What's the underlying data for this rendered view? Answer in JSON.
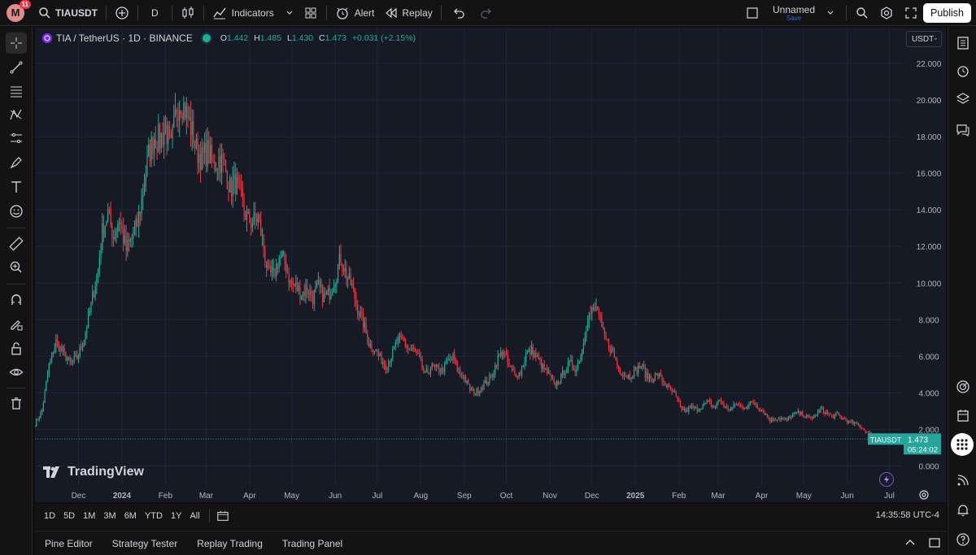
{
  "topbar": {
    "avatar_letter": "M",
    "notification_count": "11",
    "symbol": "TIAUSDT",
    "interval": "D",
    "indicators_label": "Indicators",
    "alert_label": "Alert",
    "replay_label": "Replay",
    "layout_name": "Unnamed",
    "save_label": "Save",
    "publish_label": "Publish"
  },
  "legend": {
    "title": "TIA / TetherUS · 1D · BINANCE",
    "o_label": "O",
    "o": "1.442",
    "h_label": "H",
    "h": "1.485",
    "l_label": "L",
    "l": "1.430",
    "c_label": "C",
    "c": "1.473",
    "change": "+0.031 (+2.15%)"
  },
  "currency": "USDT",
  "brand": "TradingView",
  "price_label": {
    "symbol": "TIAUSDT",
    "price": "1.473",
    "countdown": "05:24:02"
  },
  "ranges": [
    "1D",
    "5D",
    "1M",
    "3M",
    "6M",
    "YTD",
    "1Y",
    "All"
  ],
  "clock": "14:35:58 UTC-4",
  "bottom_tabs": [
    "Pine Editor",
    "Strategy Tester",
    "Replay Trading",
    "Trading Panel"
  ],
  "colors": {
    "up": "#22ab94",
    "down": "#f23645",
    "background": "#161a25",
    "label": "#26a69a"
  },
  "chart_data": {
    "type": "candlestick",
    "symbol": "TIAUSDT",
    "interval": "1D",
    "y_ticks": [
      0,
      2,
      4,
      6,
      8,
      10,
      12,
      14,
      16,
      18,
      20,
      22
    ],
    "y_tick_labels": [
      "0.000",
      "2.000",
      "4.000",
      "6.000",
      "8.000",
      "10.000",
      "12.000",
      "14.000",
      "16.000",
      "18.000",
      "20.000",
      "22.000"
    ],
    "ylim": [
      -1.0,
      22.8
    ],
    "x_tick_labels": [
      "Dec",
      "2024",
      "Feb",
      "Mar",
      "Apr",
      "May",
      "Jun",
      "Jul",
      "Aug",
      "Sep",
      "Oct",
      "Nov",
      "Dec",
      "2025",
      "Feb",
      "Mar",
      "Apr",
      "May",
      "Jun",
      "Jul"
    ],
    "x_tick_dates": [
      "2023-12-01",
      "2024-01-01",
      "2024-02-01",
      "2024-03-01",
      "2024-04-01",
      "2024-05-01",
      "2024-06-01",
      "2024-07-01",
      "2024-08-01",
      "2024-09-01",
      "2024-10-01",
      "2024-11-01",
      "2024-12-01",
      "2025-01-01",
      "2025-02-01",
      "2025-03-01",
      "2025-04-01",
      "2025-05-01",
      "2025-06-01",
      "2025-07-01"
    ],
    "start_date": "2023-10-31",
    "last_close": 1.473,
    "close_path": [
      [
        "2023-10-31",
        2.3
      ],
      [
        "2023-11-05",
        3.0
      ],
      [
        "2023-11-10",
        5.5
      ],
      [
        "2023-11-15",
        6.8
      ],
      [
        "2023-11-20",
        6.2
      ],
      [
        "2023-11-25",
        5.6
      ],
      [
        "2023-11-30",
        5.9
      ],
      [
        "2023-12-05",
        7.0
      ],
      [
        "2023-12-10",
        8.8
      ],
      [
        "2023-12-15",
        10.8
      ],
      [
        "2023-12-18",
        12.8
      ],
      [
        "2023-12-22",
        13.8
      ],
      [
        "2023-12-26",
        12.5
      ],
      [
        "2023-12-30",
        13.5
      ],
      [
        "2024-01-04",
        11.8
      ],
      [
        "2024-01-08",
        12.4
      ],
      [
        "2024-01-12",
        13.2
      ],
      [
        "2024-01-16",
        15.0
      ],
      [
        "2024-01-20",
        17.0
      ],
      [
        "2024-01-24",
        18.0
      ],
      [
        "2024-01-28",
        17.8
      ],
      [
        "2024-02-01",
        18.5
      ],
      [
        "2024-02-05",
        17.3
      ],
      [
        "2024-02-09",
        19.6
      ],
      [
        "2024-02-12",
        20.0
      ],
      [
        "2024-02-15",
        19.5
      ],
      [
        "2024-02-19",
        18.5
      ],
      [
        "2024-02-23",
        17.3
      ],
      [
        "2024-02-27",
        16.8
      ],
      [
        "2024-03-02",
        17.2
      ],
      [
        "2024-03-06",
        16.4
      ],
      [
        "2024-03-10",
        16.8
      ],
      [
        "2024-03-14",
        16.4
      ],
      [
        "2024-03-18",
        15.2
      ],
      [
        "2024-03-22",
        15.5
      ],
      [
        "2024-03-26",
        14.6
      ],
      [
        "2024-03-30",
        13.5
      ],
      [
        "2024-04-03",
        13.3
      ],
      [
        "2024-04-07",
        13.6
      ],
      [
        "2024-04-11",
        12.0
      ],
      [
        "2024-04-14",
        10.5
      ],
      [
        "2024-04-18",
        10.4
      ],
      [
        "2024-04-22",
        11.4
      ],
      [
        "2024-04-26",
        11.2
      ],
      [
        "2024-04-30",
        10.0
      ],
      [
        "2024-05-04",
        9.8
      ],
      [
        "2024-05-08",
        9.4
      ],
      [
        "2024-05-12",
        9.7
      ],
      [
        "2024-05-16",
        9.2
      ],
      [
        "2024-05-20",
        9.8
      ],
      [
        "2024-05-24",
        9.2
      ],
      [
        "2024-05-28",
        9.5
      ],
      [
        "2024-06-01",
        10.3
      ],
      [
        "2024-06-05",
        11.4
      ],
      [
        "2024-06-09",
        10.4
      ],
      [
        "2024-06-13",
        9.8
      ],
      [
        "2024-06-17",
        8.6
      ],
      [
        "2024-06-21",
        7.8
      ],
      [
        "2024-06-25",
        6.7
      ],
      [
        "2024-06-29",
        6.4
      ],
      [
        "2024-07-03",
        5.9
      ],
      [
        "2024-07-07",
        5.5
      ],
      [
        "2024-07-11",
        6.0
      ],
      [
        "2024-07-15",
        6.8
      ],
      [
        "2024-07-19",
        6.9
      ],
      [
        "2024-07-23",
        6.4
      ],
      [
        "2024-07-27",
        6.3
      ],
      [
        "2024-07-31",
        5.8
      ],
      [
        "2024-08-04",
        5.0
      ],
      [
        "2024-08-08",
        5.4
      ],
      [
        "2024-08-12",
        5.3
      ],
      [
        "2024-08-16",
        5.2
      ],
      [
        "2024-08-20",
        5.7
      ],
      [
        "2024-08-24",
        5.9
      ],
      [
        "2024-08-28",
        5.2
      ],
      [
        "2024-09-01",
        4.8
      ],
      [
        "2024-09-05",
        4.2
      ],
      [
        "2024-09-09",
        4.0
      ],
      [
        "2024-09-13",
        4.3
      ],
      [
        "2024-09-17",
        4.6
      ],
      [
        "2024-09-21",
        5.0
      ],
      [
        "2024-09-25",
        5.9
      ],
      [
        "2024-09-29",
        6.3
      ],
      [
        "2024-10-03",
        5.4
      ],
      [
        "2024-10-07",
        5.0
      ],
      [
        "2024-10-11",
        5.1
      ],
      [
        "2024-10-15",
        6.1
      ],
      [
        "2024-10-19",
        6.3
      ],
      [
        "2024-10-23",
        5.9
      ],
      [
        "2024-10-27",
        5.4
      ],
      [
        "2024-10-31",
        5.0
      ],
      [
        "2024-11-04",
        4.4
      ],
      [
        "2024-11-08",
        4.7
      ],
      [
        "2024-11-12",
        5.3
      ],
      [
        "2024-11-16",
        5.6
      ],
      [
        "2024-11-20",
        5.3
      ],
      [
        "2024-11-24",
        6.4
      ],
      [
        "2024-11-28",
        8.2
      ],
      [
        "2024-12-02",
        8.5
      ],
      [
        "2024-12-05",
        8.6
      ],
      [
        "2024-12-08",
        7.4
      ],
      [
        "2024-12-12",
        6.7
      ],
      [
        "2024-12-16",
        6.2
      ],
      [
        "2024-12-20",
        5.3
      ],
      [
        "2024-12-24",
        5.0
      ],
      [
        "2024-12-28",
        4.9
      ],
      [
        "2025-01-01",
        5.2
      ],
      [
        "2025-01-05",
        5.5
      ],
      [
        "2025-01-09",
        4.9
      ],
      [
        "2025-01-13",
        4.8
      ],
      [
        "2025-01-17",
        5.0
      ],
      [
        "2025-01-21",
        4.6
      ],
      [
        "2025-01-25",
        4.2
      ],
      [
        "2025-01-29",
        3.9
      ],
      [
        "2025-02-02",
        3.2
      ],
      [
        "2025-02-06",
        3.0
      ],
      [
        "2025-02-10",
        3.2
      ],
      [
        "2025-02-14",
        3.1
      ],
      [
        "2025-02-18",
        3.3
      ],
      [
        "2025-02-22",
        3.5
      ],
      [
        "2025-02-26",
        3.2
      ],
      [
        "2025-03-02",
        3.6
      ],
      [
        "2025-03-06",
        3.2
      ],
      [
        "2025-03-10",
        3.1
      ],
      [
        "2025-03-14",
        3.4
      ],
      [
        "2025-03-18",
        3.2
      ],
      [
        "2025-03-22",
        3.3
      ],
      [
        "2025-03-26",
        3.5
      ],
      [
        "2025-03-30",
        3.2
      ],
      [
        "2025-04-03",
        2.9
      ],
      [
        "2025-04-07",
        2.5
      ],
      [
        "2025-04-11",
        2.6
      ],
      [
        "2025-04-15",
        2.6
      ],
      [
        "2025-04-19",
        2.5
      ],
      [
        "2025-04-23",
        2.8
      ],
      [
        "2025-04-27",
        2.9
      ],
      [
        "2025-05-01",
        2.8
      ],
      [
        "2025-05-05",
        2.6
      ],
      [
        "2025-05-09",
        2.7
      ],
      [
        "2025-05-13",
        3.1
      ],
      [
        "2025-05-17",
        2.9
      ],
      [
        "2025-05-21",
        2.7
      ],
      [
        "2025-05-25",
        2.8
      ],
      [
        "2025-05-29",
        2.6
      ],
      [
        "2025-06-02",
        2.4
      ],
      [
        "2025-06-06",
        2.3
      ],
      [
        "2025-06-10",
        2.2
      ],
      [
        "2025-06-14",
        1.9
      ],
      [
        "2025-06-18",
        1.7
      ],
      [
        "2025-06-22",
        1.45
      ],
      [
        "2025-06-24",
        1.473
      ]
    ]
  }
}
